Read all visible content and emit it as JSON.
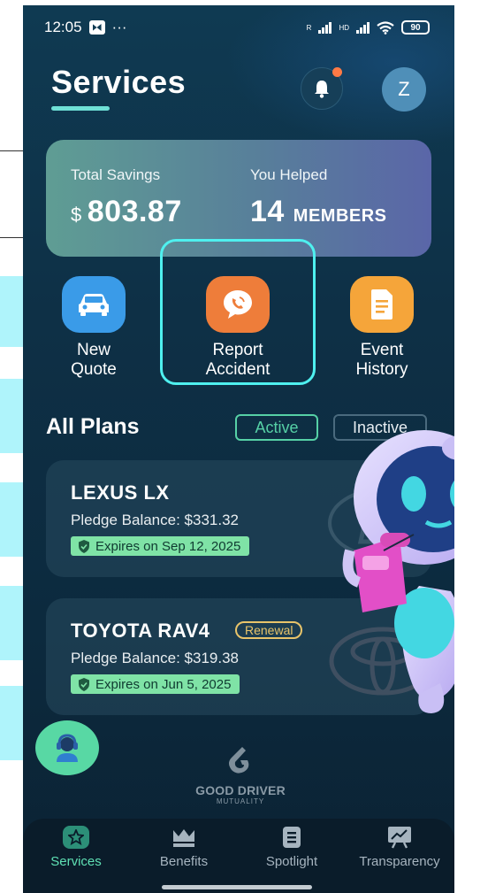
{
  "status_bar": {
    "time": "12:05",
    "dots": "···",
    "net1": "R",
    "net2": "HD",
    "battery": "90"
  },
  "header": {
    "title": "Services",
    "avatar_initial": "Z"
  },
  "savings": {
    "total_label": "Total Savings",
    "currency": "$",
    "total_value": "803.87",
    "helped_label": "You Helped",
    "helped_count": "14",
    "helped_unit": "MEMBERS"
  },
  "actions": [
    {
      "label": "New\nQuote",
      "color": "#3a9be8"
    },
    {
      "label": "Report\nAccident",
      "color": "#ee7d3a"
    },
    {
      "label": "Event\nHistory",
      "color": "#f5a53a"
    }
  ],
  "plans": {
    "title": "All Plans",
    "tab_active": "Active",
    "tab_inactive": "Inactive",
    "items": [
      {
        "name": "LEXUS LX",
        "balance": "Pledge Balance: $331.32",
        "expires": "Expires on Sep 12, 2025"
      },
      {
        "name": "TOYOTA RAV4",
        "badge": "Renewal",
        "balance": "Pledge Balance: $319.38",
        "expires": "Expires on Jun 5, 2025"
      }
    ]
  },
  "brand": {
    "name": "GOOD DRIVER",
    "sub": "MUTUALITY"
  },
  "nav": [
    {
      "label": "Services",
      "icon": "star-badge-icon",
      "active": true
    },
    {
      "label": "Benefits",
      "icon": "crown-icon"
    },
    {
      "label": "Spotlight",
      "icon": "document-icon"
    },
    {
      "label": "Transparency",
      "icon": "chart-board-icon"
    }
  ],
  "colors": {
    "accent": "#5fe0b4",
    "highlight": "#4ff0ef",
    "expiry_badge": "#7fe3a6",
    "renewal": "#e8c46a"
  }
}
